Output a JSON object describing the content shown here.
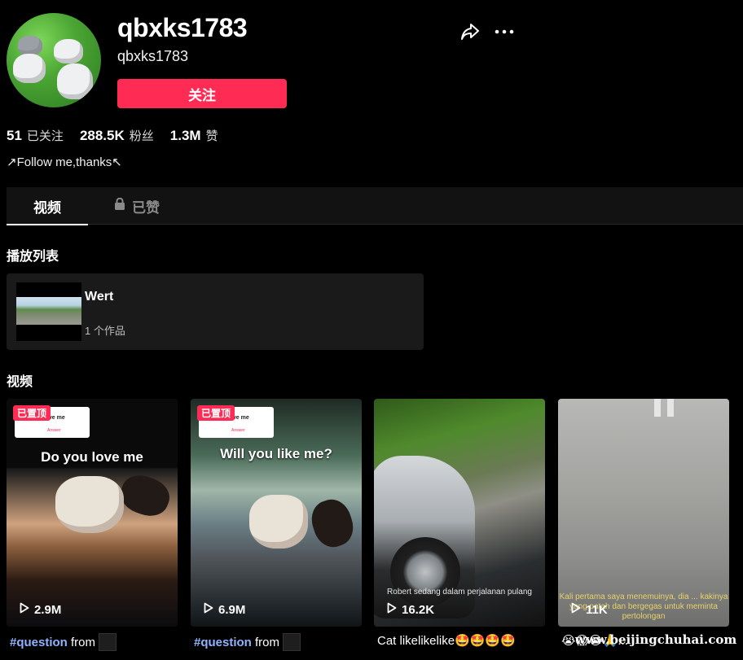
{
  "profile": {
    "username": "qbxks1783",
    "nickname": "qbxks1783",
    "follow_label": "关注",
    "stats": {
      "following_count": "51",
      "following_label": "已关注",
      "followers_count": "288.5K",
      "followers_label": "粉丝",
      "likes_count": "1.3M",
      "likes_label": "赞"
    },
    "bio": "↗Follow me,thanks↖"
  },
  "tabs": {
    "videos": "视频",
    "liked": "已赞"
  },
  "playlist": {
    "section_title": "播放列表",
    "items": [
      {
        "title": "Wert",
        "count": "1 个作品"
      }
    ]
  },
  "videos_section": {
    "title": "视频",
    "items": [
      {
        "pinned_label": "已置顶",
        "card_question": "Do you love me",
        "card_answer": "Answer",
        "overlay_title": "Do you love me",
        "views": "2.9M",
        "caption_tag": "#question",
        "caption_text": " from"
      },
      {
        "pinned_label": "已置顶",
        "card_question": "Do you love me",
        "card_answer": "Answer",
        "overlay_title": "Will you like me?",
        "views": "6.9M",
        "caption_tag": "#question",
        "caption_text": " from"
      },
      {
        "subtitle": "Robert sedang dalam perjalanan pulang",
        "views": "16.2K",
        "caption_text": "Cat likelikelike🤩🤩🤩🤩"
      },
      {
        "subtitle": "Kali pertama saya menemuinya, dia ... kakinya yang patah dan bergegas untuk meminta pertolongan",
        "views": "11K",
        "caption_text": "😭😱😭🙏..."
      }
    ]
  },
  "watermark": "www.beijingchuhai.com",
  "colors": {
    "accent": "#fe2c55",
    "background": "#000000",
    "tab_bar": "#121212",
    "card": "#1a1a1a"
  }
}
